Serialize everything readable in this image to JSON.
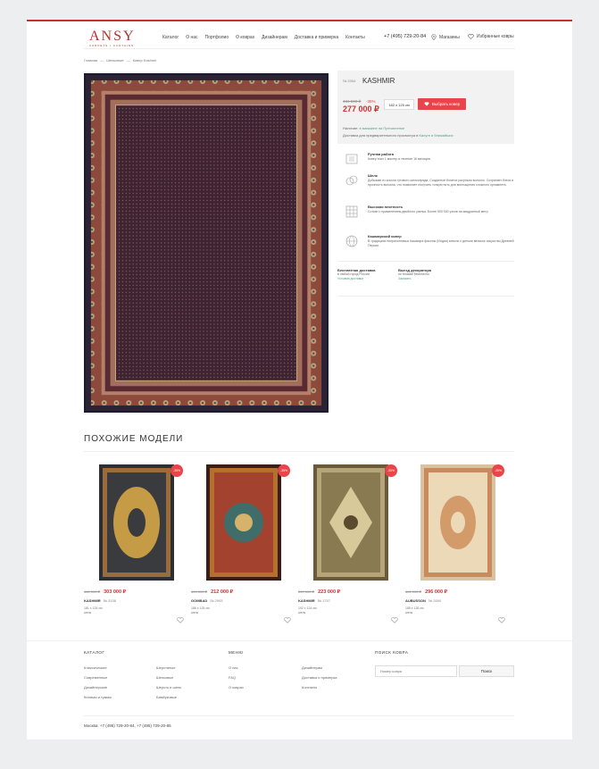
{
  "header": {
    "logo": "ANSY",
    "logo_sub": "CARPETS ▪ CURTAINS",
    "nav": [
      "Каталог",
      "О нас",
      "Портфолио",
      "О коврах",
      "Дизайнерам",
      "Доставка и примерка",
      "Контакты"
    ],
    "phone": "+7 (495) 729-20-84",
    "stores": "Магазины",
    "favorites": "Избранные ковры"
  },
  "breadcrumbs": [
    "Главная",
    "—",
    "Шелковые",
    "—",
    "Ковер Kashmir"
  ],
  "product": {
    "sku": "№ 3354",
    "title": "KASHMIR",
    "old_price": "431 500 ₽",
    "discount": "-35%",
    "price": "277 000 ₽",
    "size": "182 x 125 см",
    "buy": "Выбрать ковер",
    "availability_prefix": "Наличие:",
    "availability_link": "в магазине на Пречистенке",
    "delivery_prefix": "Доставка для предварительного просмотра в",
    "delivery_link": "Калуге и ближайших"
  },
  "features": [
    {
      "icon": "hand-icon",
      "title": "Ручная работа",
      "text": "Ковер ткал 1 мастер в течение 16 месяцев."
    },
    {
      "icon": "silk-icon",
      "title": "Шелк",
      "text": "Добываю из кокона тутового шелкопряда. Созданное богатое рисунком волокно. Сохраняет блеск и прочность волокна, что позволяет получить тонкую нить для воплощения сложного орнамента."
    },
    {
      "icon": "density-icon",
      "title": "Высокая плотность",
      "text": "Соткан с применением двойного узелка. Более 900 000 узлов на квадратный метр."
    },
    {
      "icon": "globe-icon",
      "title": "Кашмирский ковер",
      "text": "В традициях неприхотливых Кашмира фасоны (Индия) внесли с детьми великое искусство Древней Персии."
    }
  ],
  "delivery": [
    {
      "title": "Бесплатная доставка",
      "text": "в любой город России",
      "link": "Условия доставки"
    },
    {
      "title": "Выезд декоратора",
      "text": "по Москве бесплатно",
      "link": "Заказать"
    }
  ],
  "similar": {
    "heading": "ПОХОЖИЕ МОДЕЛИ",
    "items": [
      {
        "badge": "-35%",
        "old": "462 000 ₽",
        "price": "303 000 ₽",
        "name": "KASHMIR",
        "sku": "№ 3158",
        "size": "181 x 125 см",
        "material": "шелк"
      },
      {
        "badge": "-35%",
        "old": "409 000 ₽",
        "price": "212 000 ₽",
        "name": "GOMBAD",
        "sku": "№ 2993",
        "size": "186 x 125 см",
        "material": "шелк"
      },
      {
        "badge": "-30%",
        "old": "337 000 ₽",
        "price": "223 000 ₽",
        "name": "KASHMIR",
        "sku": "№ 1757",
        "size": "192 x 124 см",
        "material": "шелк"
      },
      {
        "badge": "-35%",
        "old": "461 000 ₽",
        "price": "296 000 ₽",
        "name": "AUBUSSON",
        "sku": "№ 2690",
        "size": "185 x 126 см",
        "material": "шелк"
      }
    ]
  },
  "footer": {
    "catalog_title": "КАТАЛОГ",
    "catalog_col1": [
      "Классические",
      "Современные",
      "Дизайнерские",
      "Килимы и гуммы"
    ],
    "catalog_col2": [
      "Шерстяные",
      "Шелковые",
      "Шерсть и шелк",
      "Бамбуковые"
    ],
    "menu_title": "МЕНЮ",
    "menu_col1": [
      "О нас",
      "FAQ",
      "О коврах"
    ],
    "menu_col2": [
      "Дизайнерам",
      "Доставка и примерка",
      "Контакты"
    ],
    "search_title": "ПОИСК КОВРА",
    "search_placeholder": "Номер ковра",
    "search_button": "Поиск",
    "phones": "Москва:  +7 (495) 729-20-84, +7 (495) 729-20-85"
  }
}
